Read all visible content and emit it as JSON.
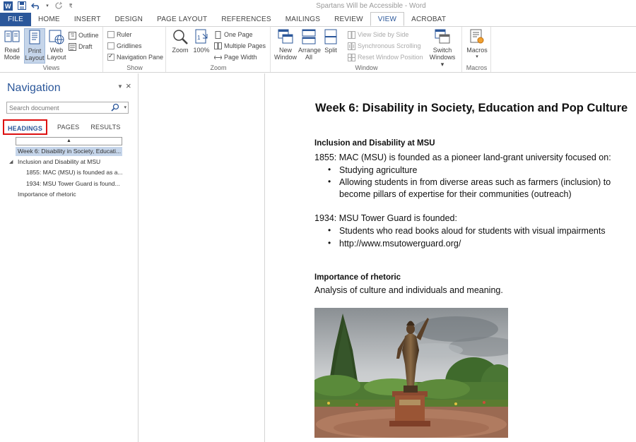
{
  "window": {
    "title": "Spartans Will be Accessible - Word"
  },
  "tabs": [
    {
      "label": "FILE"
    },
    {
      "label": "HOME"
    },
    {
      "label": "INSERT"
    },
    {
      "label": "DESIGN"
    },
    {
      "label": "PAGE LAYOUT"
    },
    {
      "label": "REFERENCES"
    },
    {
      "label": "MAILINGS"
    },
    {
      "label": "REVIEW"
    },
    {
      "label": "VIEW"
    },
    {
      "label": "ACROBAT"
    }
  ],
  "ribbon": {
    "views": {
      "label": "Views",
      "read_mode": [
        "Read",
        "Mode"
      ],
      "print_layout": [
        "Print",
        "Layout"
      ],
      "web_layout": [
        "Web",
        "Layout"
      ],
      "outline": "Outline",
      "draft": "Draft"
    },
    "show": {
      "label": "Show",
      "ruler": "Ruler",
      "gridlines": "Gridlines",
      "navigation_pane": "Navigation Pane"
    },
    "zoom": {
      "label": "Zoom",
      "zoom": "Zoom",
      "percent": "100%",
      "one_page": "One Page",
      "multiple_pages": "Multiple Pages",
      "page_width": "Page Width"
    },
    "window": {
      "label": "Window",
      "new_window": [
        "New",
        "Window"
      ],
      "arrange_all": [
        "Arrange",
        "All"
      ],
      "split": "Split",
      "view_side_by_side": "View Side by Side",
      "synchronous_scrolling": "Synchronous Scrolling",
      "reset_window_position": "Reset Window Position",
      "switch_windows": [
        "Switch",
        "Windows ▾"
      ]
    },
    "macros": {
      "label": "Macros",
      "macros": "Macros",
      "dropdown": "▾"
    }
  },
  "navigation": {
    "title": "Navigation",
    "search_placeholder": "Search document",
    "tabs": [
      "HEADINGS",
      "PAGES",
      "RESULTS"
    ],
    "headings": [
      {
        "text": "Week 6: Disability in Society, Educati...",
        "selected": true
      },
      {
        "text": "Inclusion and Disability at MSU"
      },
      {
        "text": "1855: MAC (MSU) is founded as a..."
      },
      {
        "text": "1934: MSU Tower Guard is found..."
      },
      {
        "text": "Importance of rhetoric"
      }
    ]
  },
  "document": {
    "title": "Week 6: Disability in Society, Education and Pop Culture",
    "section1_heading": "Inclusion and Disability at MSU",
    "p1855": "1855: MAC (MSU) is founded as a pioneer land-grant university focused on:",
    "b1": "Studying agriculture",
    "b2a": "Allowing students in from diverse areas such as farmers (inclusion) to",
    "b2b": "become pillars of expertise for their communities (outreach)",
    "p1934": "1934: MSU Tower Guard is founded:",
    "b3": "Students who read books aloud for students with visual impairments",
    "b4": "http://www.msutowerguard.org/",
    "section2_heading": "Importance of rhetoric",
    "p_rhetoric": "Analysis of culture and individuals and meaning."
  },
  "colors": {
    "accent": "#2b579a",
    "selected_bg": "#c5d5ea",
    "highlight_border": "#dd1111"
  }
}
